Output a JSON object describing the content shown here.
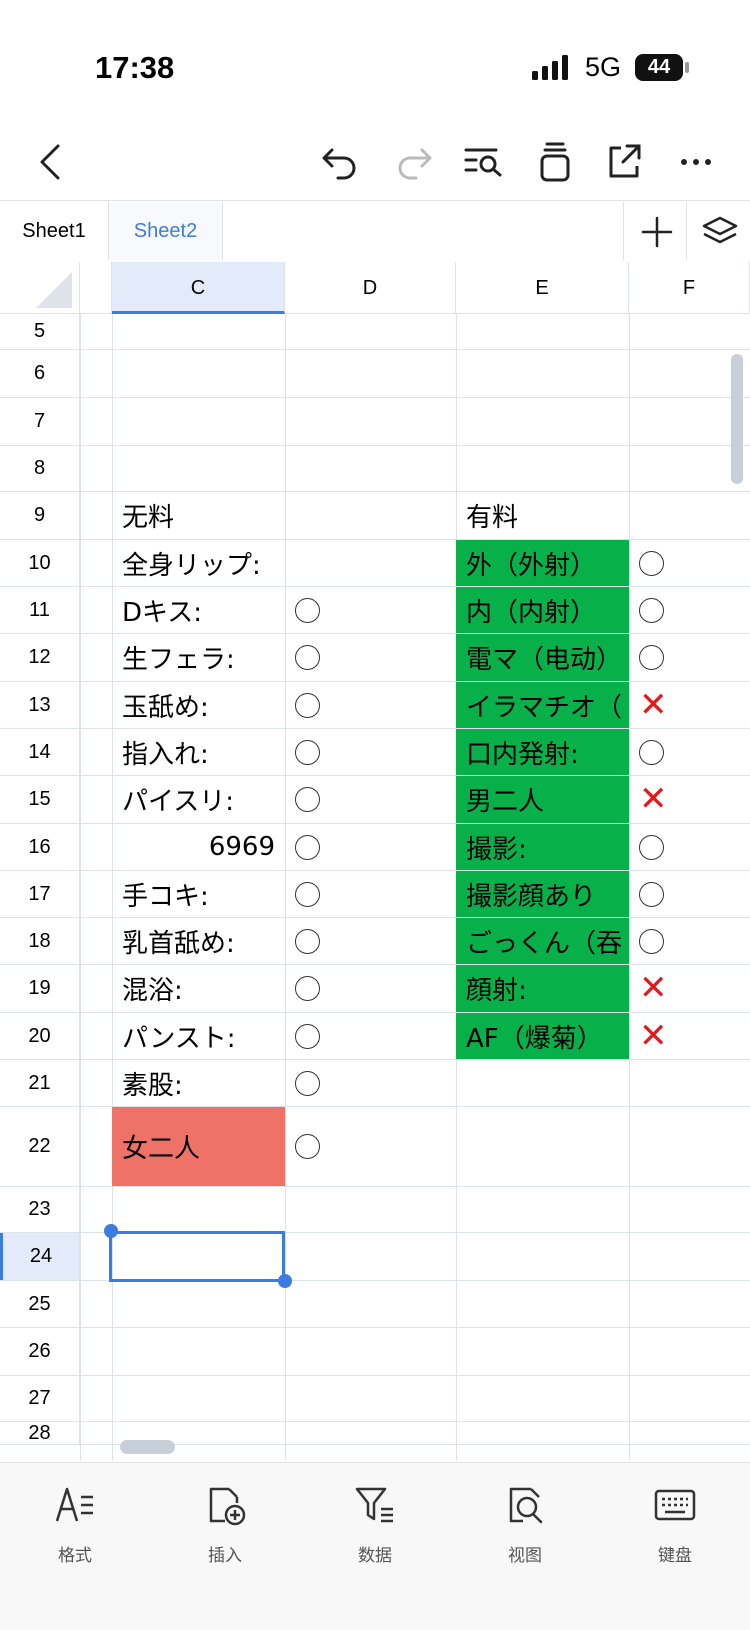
{
  "status_bar": {
    "time": "17:38",
    "network": "5G",
    "battery": "44"
  },
  "sheet_tabs": [
    {
      "label": "Sheet1"
    },
    {
      "label": "Sheet2"
    }
  ],
  "columns": [
    "C",
    "D",
    "E",
    "F"
  ],
  "rows": [
    {
      "num": "5",
      "C": "",
      "D": "",
      "E": "",
      "F": ""
    },
    {
      "num": "6",
      "C": "",
      "D": "",
      "E": "",
      "F": ""
    },
    {
      "num": "7",
      "C": "",
      "D": "",
      "E": "",
      "F": ""
    },
    {
      "num": "8",
      "C": "",
      "D": "",
      "E": "",
      "F": ""
    },
    {
      "num": "9",
      "C": "无料",
      "D": "",
      "E": "有料",
      "F": ""
    },
    {
      "num": "10",
      "C": "全身リップ:",
      "D": "",
      "E": "外（外射）",
      "F": "○"
    },
    {
      "num": "11",
      "C": "Dキス:",
      "D": "○",
      "E": "内（内射）",
      "F": "○"
    },
    {
      "num": "12",
      "C": "生フェラ:",
      "D": "○",
      "E": "電マ（电动）",
      "F": "○"
    },
    {
      "num": "13",
      "C": "玉舐め:",
      "D": "○",
      "E": "イラマチオ（",
      "F": "×"
    },
    {
      "num": "14",
      "C": "指入れ:",
      "D": "○",
      "E": "口内発射:",
      "F": "○"
    },
    {
      "num": "15",
      "C": "パイスリ:",
      "D": "○",
      "E": "男二人",
      "F": "×"
    },
    {
      "num": "16",
      "C": "6969",
      "D": "○",
      "E": "撮影:",
      "F": "○"
    },
    {
      "num": "17",
      "C": "手コキ:",
      "D": "○",
      "E": "撮影顔あり",
      "F": "○"
    },
    {
      "num": "18",
      "C": "乳首舐め:",
      "D": "○",
      "E": "ごっくん（吞",
      "F": "○"
    },
    {
      "num": "19",
      "C": "混浴:",
      "D": "○",
      "E": "顔射:",
      "F": "×"
    },
    {
      "num": "20",
      "C": "パンスト:",
      "D": "○",
      "E": "AF（爆菊）",
      "F": "×"
    },
    {
      "num": "21",
      "C": "素股:",
      "D": "○",
      "E": "",
      "F": ""
    },
    {
      "num": "22",
      "C": "女二人",
      "D": "○",
      "E": "",
      "F": ""
    },
    {
      "num": "23",
      "C": "",
      "D": "",
      "E": "",
      "F": ""
    },
    {
      "num": "24",
      "C": "",
      "D": "",
      "E": "",
      "F": ""
    },
    {
      "num": "25",
      "C": "",
      "D": "",
      "E": "",
      "F": ""
    },
    {
      "num": "26",
      "C": "",
      "D": "",
      "E": "",
      "F": ""
    },
    {
      "num": "27",
      "C": "",
      "D": "",
      "E": "",
      "F": ""
    },
    {
      "num": "28",
      "C": "",
      "D": "",
      "E": "",
      "F": ""
    }
  ],
  "selected_cell": "C24",
  "colors": {
    "green_fill": "#08b04a",
    "red_fill": "#ef7268",
    "accent": "#3c7be0",
    "cross": "#e01b1b"
  },
  "bottom_bar": [
    {
      "label": "格式",
      "icon": "format-icon"
    },
    {
      "label": "插入",
      "icon": "insert-icon"
    },
    {
      "label": "数据",
      "icon": "data-filter-icon"
    },
    {
      "label": "视图",
      "icon": "view-icon"
    },
    {
      "label": "键盘",
      "icon": "keyboard-icon"
    }
  ]
}
